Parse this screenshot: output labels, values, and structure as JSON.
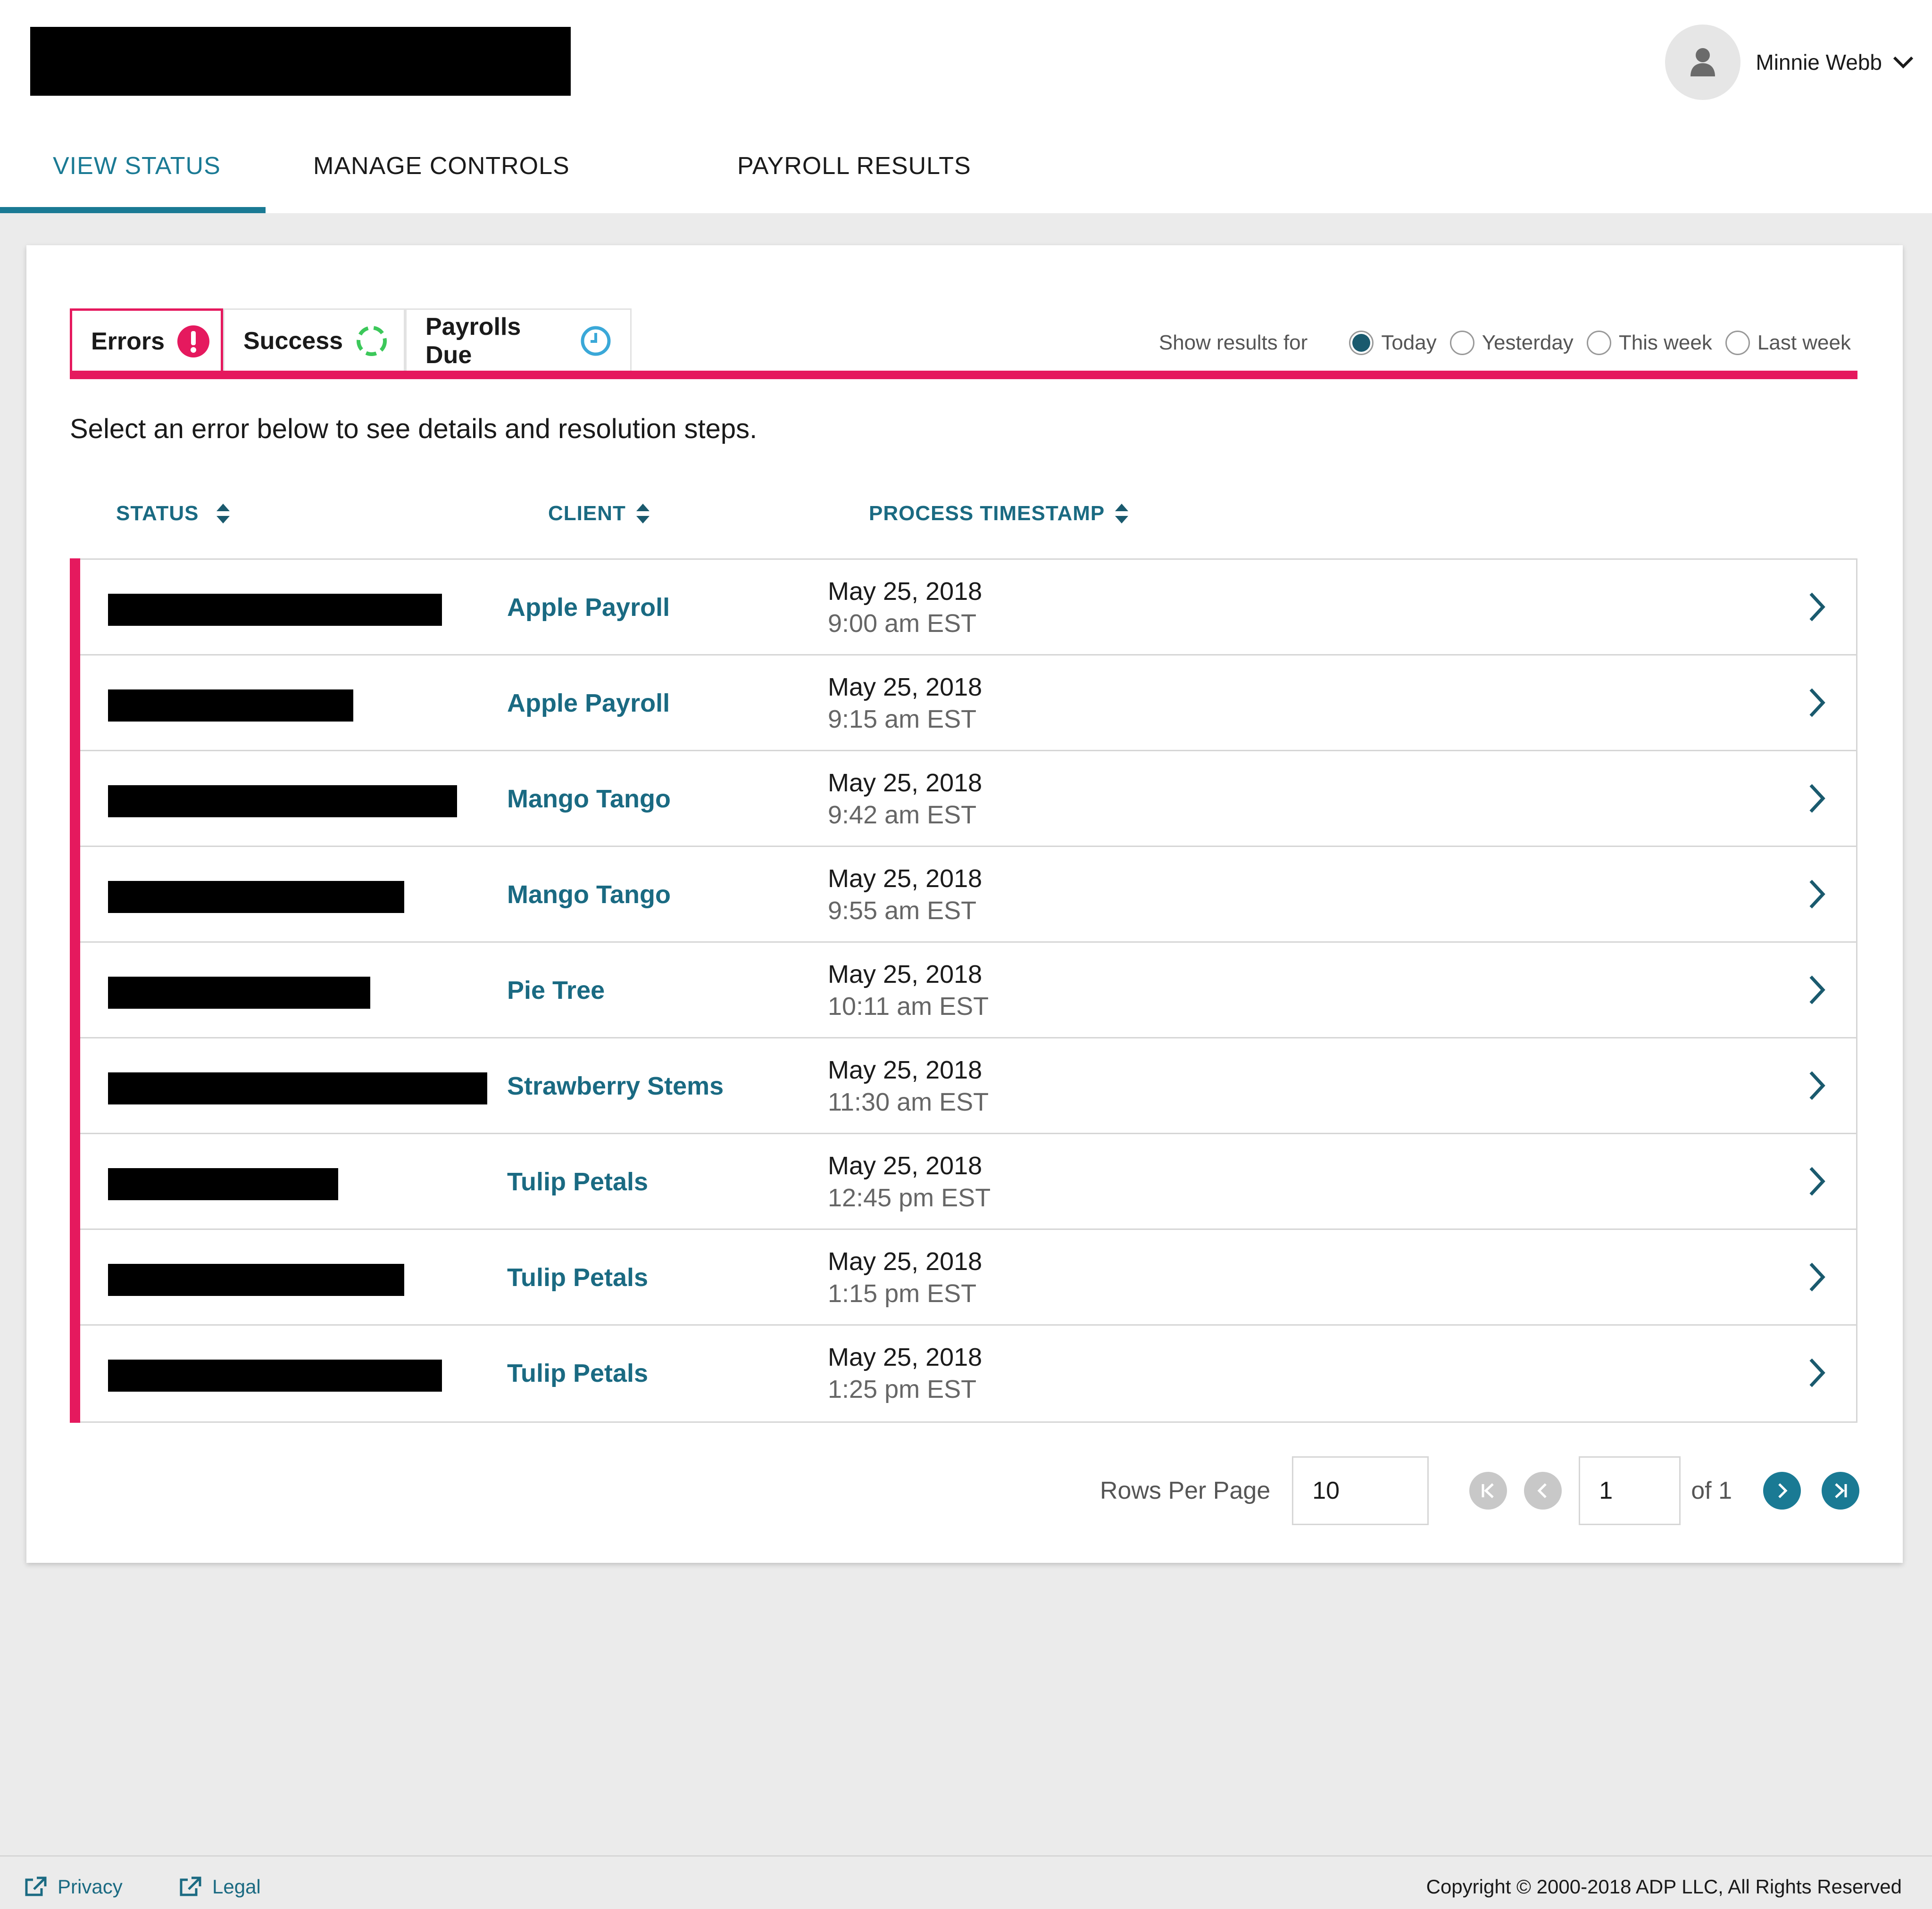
{
  "header": {
    "user_name": "Minnie Webb"
  },
  "nav": {
    "tabs": [
      {
        "label": "VIEW STATUS",
        "active": true
      },
      {
        "label": "MANAGE CONTROLS",
        "active": false
      },
      {
        "label": "PAYROLL RESULTS",
        "active": false
      }
    ]
  },
  "subtabs": {
    "errors": "Errors",
    "success": "Success",
    "payrolls_due": "Payrolls Due"
  },
  "filter": {
    "label": "Show results for",
    "options": [
      "Today",
      "Yesterday",
      "This week",
      "Last week"
    ],
    "selected": "Today"
  },
  "instruction": "Select an error below to see details and resolution steps.",
  "columns": {
    "status": "STATUS",
    "client": "CLIENT",
    "timestamp": "PROCESS TIMESTAMP"
  },
  "rows": [
    {
      "client": "Apple Payroll",
      "date": "May 25, 2018",
      "time": "9:00 am EST"
    },
    {
      "client": "Apple Payroll",
      "date": "May 25, 2018",
      "time": "9:15 am EST"
    },
    {
      "client": "Mango Tango",
      "date": "May 25, 2018",
      "time": "9:42 am EST"
    },
    {
      "client": "Mango Tango",
      "date": "May 25, 2018",
      "time": "9:55 am EST"
    },
    {
      "client": "Pie Tree",
      "date": "May 25, 2018",
      "time": "10:11 am EST"
    },
    {
      "client": "Strawberry Stems",
      "date": "May 25, 2018",
      "time": "11:30 am EST"
    },
    {
      "client": "Tulip Petals",
      "date": "May 25, 2018",
      "time": "12:45 pm EST"
    },
    {
      "client": "Tulip Petals",
      "date": "May 25, 2018",
      "time": "1:15 pm EST"
    },
    {
      "client": "Tulip Petals",
      "date": "May 25, 2018",
      "time": "1:25 pm EST"
    }
  ],
  "pagination": {
    "rows_per_page_label": "Rows Per Page",
    "rows_per_page": "10",
    "page": "1",
    "of_label": "of 1"
  },
  "footer": {
    "privacy": "Privacy",
    "legal": "Legal",
    "copyright": "Copyright © 2000-2018 ADP LLC, All Rights Reserved"
  },
  "colors": {
    "accent": "#1a7a94",
    "error": "#e5195e",
    "success": "#3cc85a",
    "due": "#3aa8d8"
  },
  "icons": {
    "user": "user-icon",
    "dropdown": "chevron-down-icon",
    "error": "exclamation-icon",
    "success": "refresh-icon",
    "due": "clock-icon",
    "sort": "sort-icon",
    "row": "chevron-right-icon",
    "external": "external-link-icon"
  }
}
